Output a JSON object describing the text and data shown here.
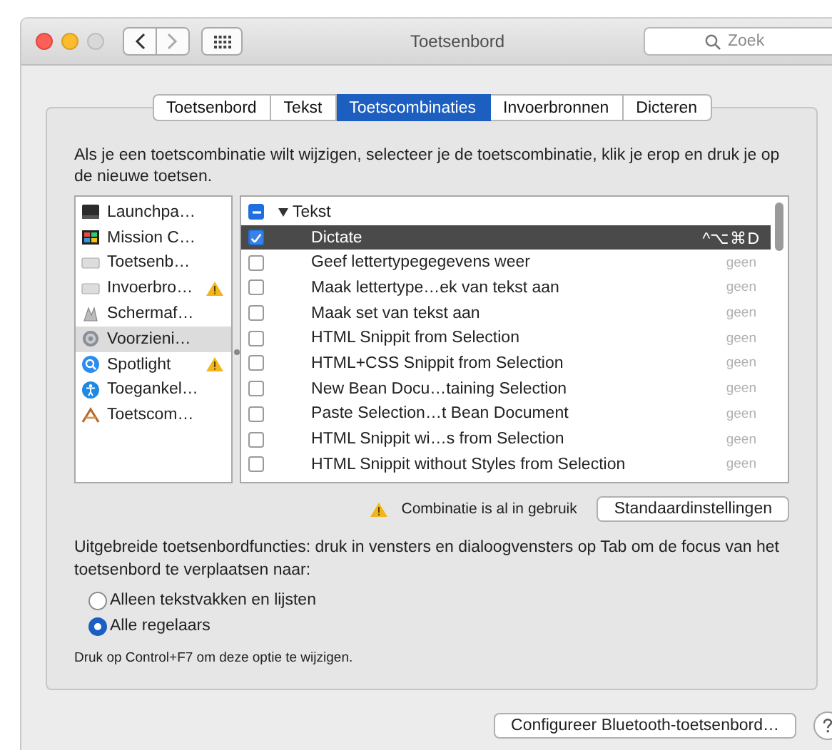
{
  "window": {
    "title": "Toetsenbord"
  },
  "search": {
    "placeholder": "Zoek"
  },
  "tabs": [
    {
      "label": "Toetsenbord",
      "selected": false
    },
    {
      "label": "Tekst",
      "selected": false
    },
    {
      "label": "Toetscombinaties",
      "selected": true
    },
    {
      "label": "Invoerbronnen",
      "selected": false
    },
    {
      "label": "Dicteren",
      "selected": false
    }
  ],
  "description": "Als je een toetscombinatie wilt wijzigen, selecteer je de toetscombinatie, klik je erop en druk je op de nieuwe toetsen.",
  "categories": [
    {
      "kind": "launchpad",
      "label": "Launchpa…",
      "warning": false,
      "selected": false
    },
    {
      "kind": "mission",
      "label": "Mission C…",
      "warning": false,
      "selected": false
    },
    {
      "kind": "keyboard",
      "label": "Toetsenb…",
      "warning": false,
      "selected": false
    },
    {
      "kind": "keyboard",
      "label": "Invoerbro…",
      "warning": true,
      "selected": false
    },
    {
      "kind": "screenshot",
      "label": "Schermaf…",
      "warning": false,
      "selected": false
    },
    {
      "kind": "gear",
      "label": "Voorzieni…",
      "warning": false,
      "selected": true
    },
    {
      "kind": "spotlight",
      "label": "Spotlight",
      "warning": true,
      "selected": false
    },
    {
      "kind": "accessibility",
      "label": "Toegankel…",
      "warning": false,
      "selected": false
    },
    {
      "kind": "app",
      "label": "Toetscom…",
      "warning": false,
      "selected": false
    }
  ],
  "group": {
    "label": "Tekst",
    "expanded": true,
    "mixed": true
  },
  "shortcuts": [
    {
      "label": "Dictate",
      "keys": "^⌥⌘D",
      "checked": true,
      "selected": true
    },
    {
      "label": "Geef lettertypegegevens weer",
      "keys": "geen",
      "checked": false,
      "selected": false
    },
    {
      "label": "Maak lettertype…ek van tekst aan",
      "keys": "geen",
      "checked": false,
      "selected": false
    },
    {
      "label": "Maak set van tekst aan",
      "keys": "geen",
      "checked": false,
      "selected": false
    },
    {
      "label": "HTML Snippit from Selection",
      "keys": "geen",
      "checked": false,
      "selected": false
    },
    {
      "label": "HTML+CSS Snippit from Selection",
      "keys": "geen",
      "checked": false,
      "selected": false
    },
    {
      "label": "New Bean Docu…taining Selection",
      "keys": "geen",
      "checked": false,
      "selected": false
    },
    {
      "label": "Paste Selection…t Bean Document",
      "keys": "geen",
      "checked": false,
      "selected": false
    },
    {
      "label": "HTML Snippit wi…s from Selection",
      "keys": "geen",
      "checked": false,
      "selected": false
    },
    {
      "label": "HTML Snippit without Styles from Selection",
      "keys": "geen",
      "checked": false,
      "selected": false
    }
  ],
  "conflict_note": "Combinatie is al in gebruik",
  "defaults_button": "Standaardinstellingen",
  "full_keyboard": {
    "text": "Uitgebreide toetsenbordfuncties: druk in vensters en dialoogvensters op Tab om de focus van het toetsenbord te verplaatsen naar:",
    "options": [
      {
        "label": "Alleen tekstvakken en lijsten",
        "selected": false
      },
      {
        "label": "Alle regelaars",
        "selected": true
      }
    ],
    "hint": "Druk op Control+F7 om deze optie te wijzigen."
  },
  "bluetooth_button": "Configureer Bluetooth-toetsenbord…"
}
